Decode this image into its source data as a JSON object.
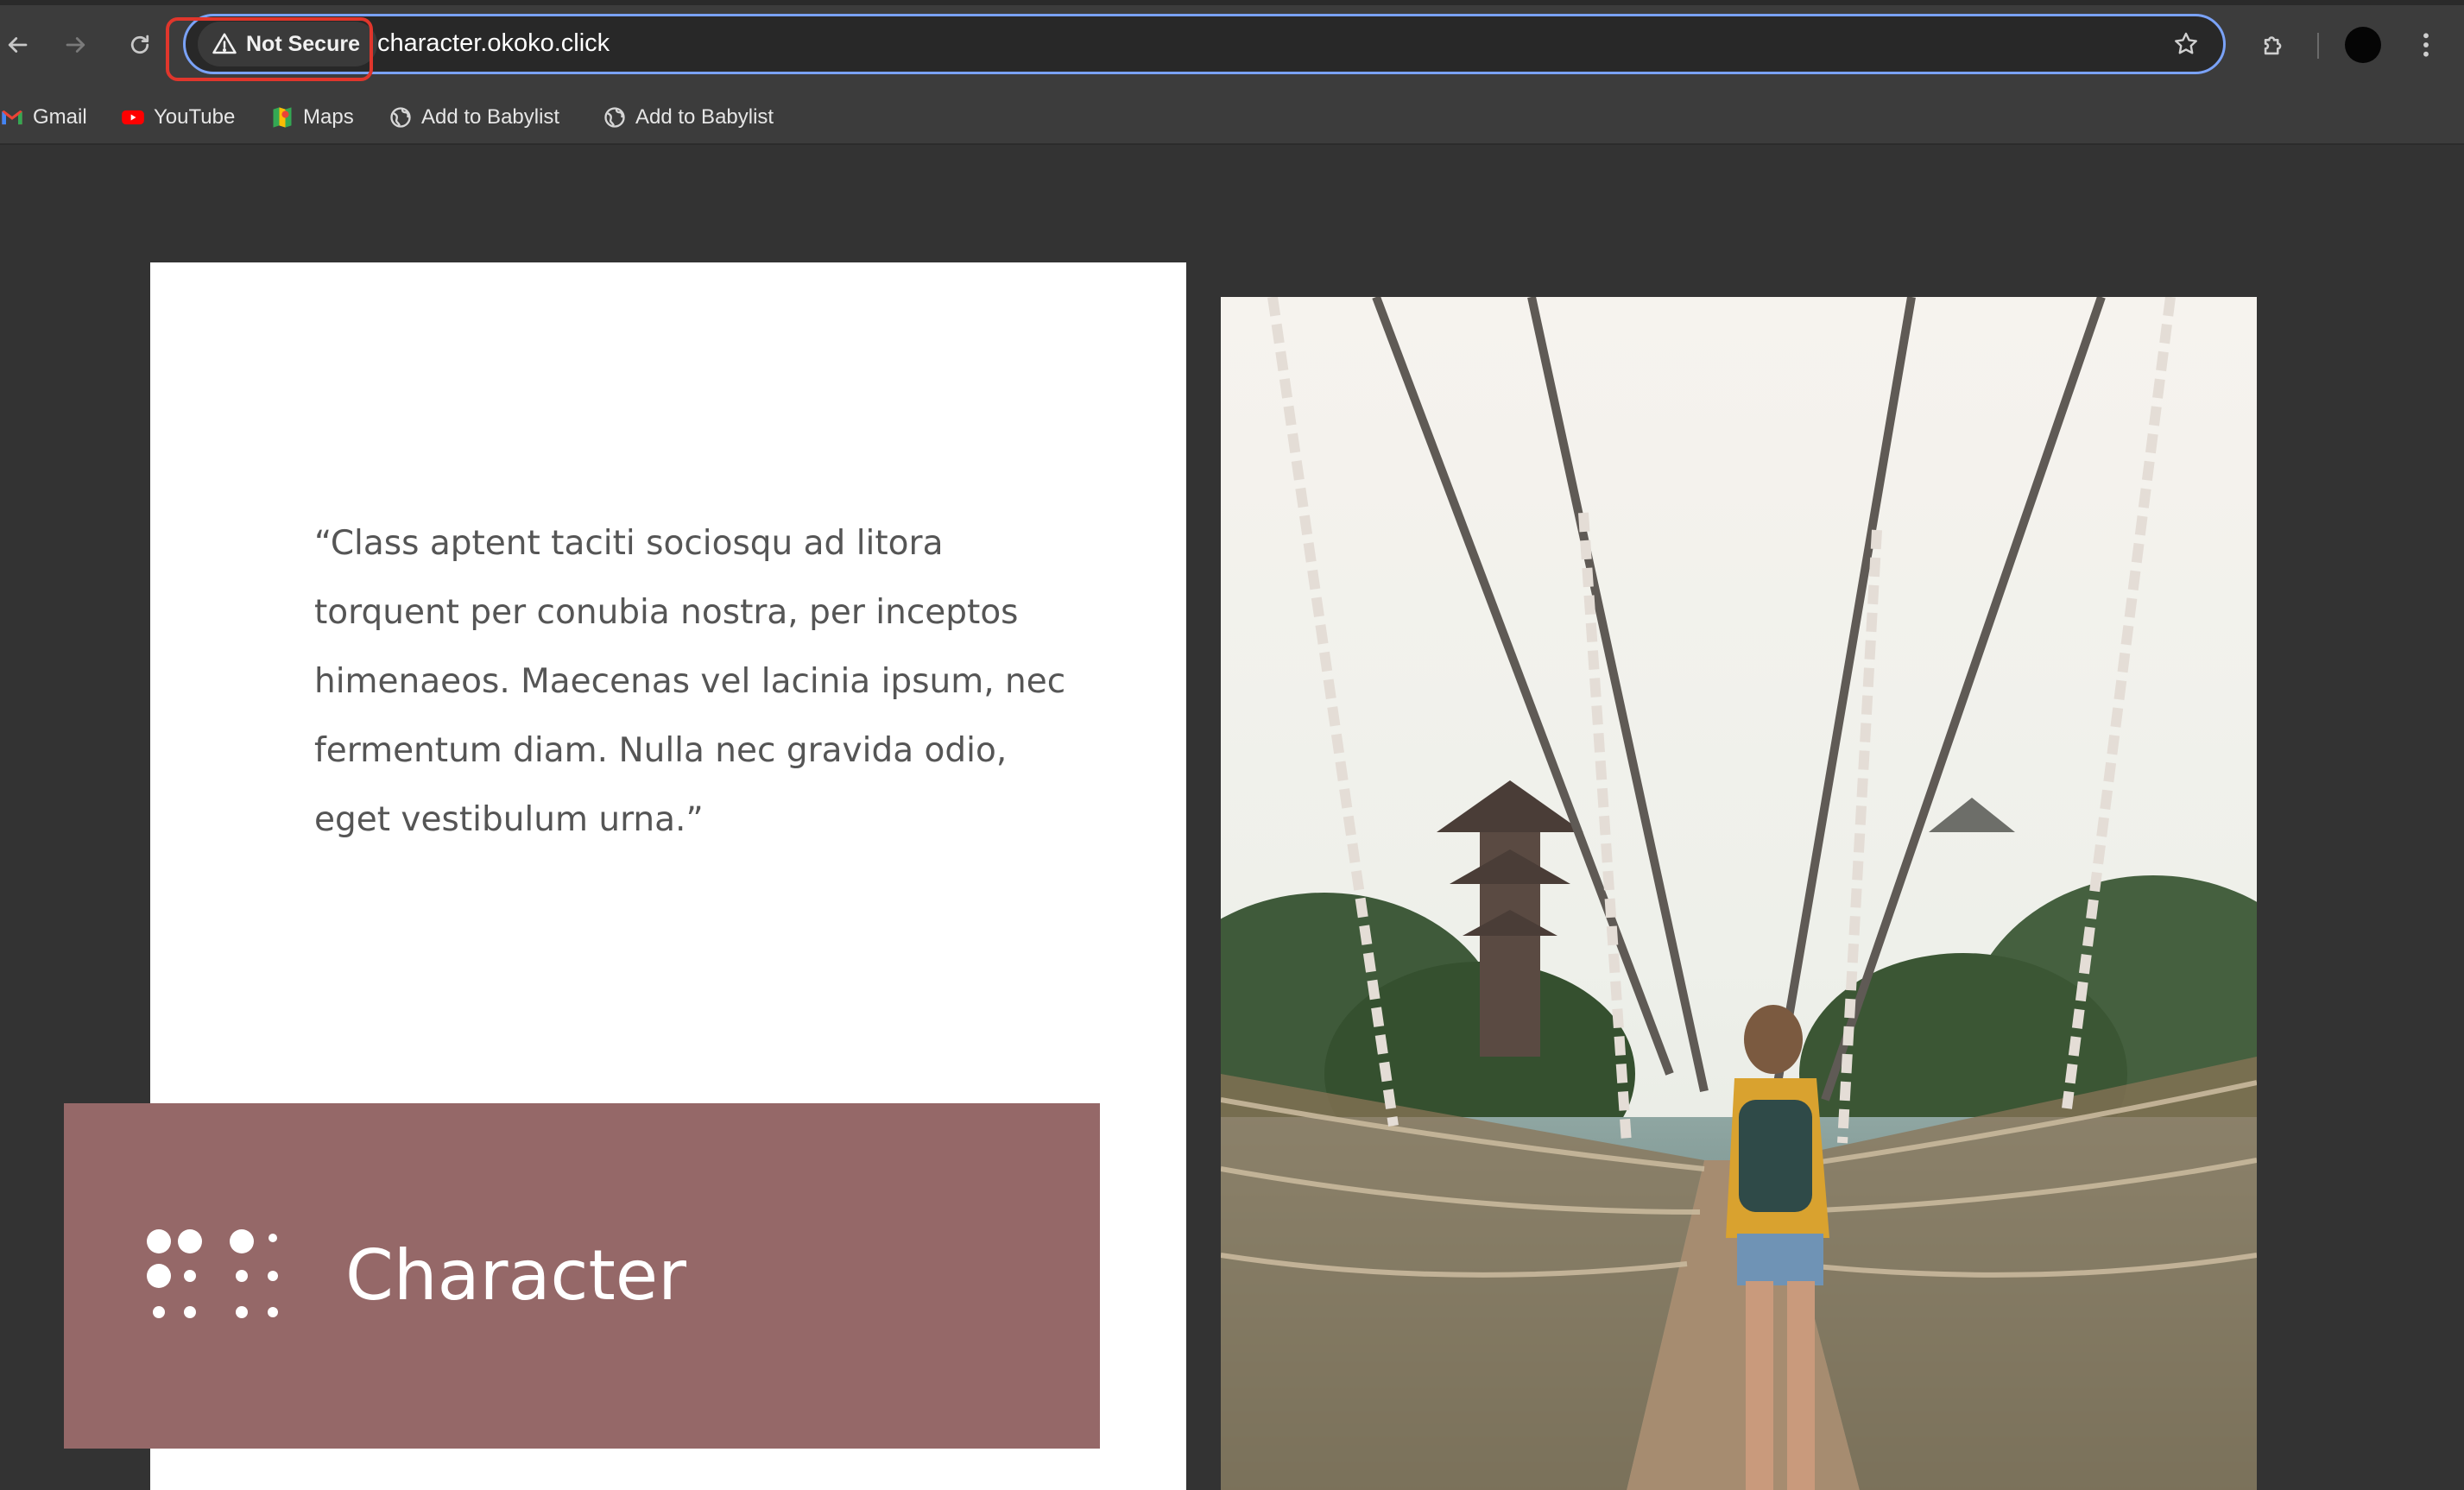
{
  "browser": {
    "security_label": "Not Secure",
    "url": "character.okoko.click",
    "bookmarks": [
      {
        "label": "Gmail",
        "icon": "gmail-icon"
      },
      {
        "label": "YouTube",
        "icon": "youtube-icon"
      },
      {
        "label": "Maps",
        "icon": "maps-icon"
      },
      {
        "label": "Add to Babylist",
        "icon": "globe-icon"
      },
      {
        "label": "Add to Babylist",
        "icon": "globe-icon"
      }
    ],
    "annotation_color": "#e0362c"
  },
  "page": {
    "quote": "“Class aptent taciti sociosqu ad litora torquent per conubia nostra, per inceptos himenaeos. Maecenas vel lacinia ipsum, nec fermentum diam. Nulla nec gravida odio, eget vestibulum urna.”",
    "banner": {
      "title": "Character",
      "background_color": "#956868"
    },
    "photo": {
      "icon": "rope-bridge-photo"
    }
  }
}
